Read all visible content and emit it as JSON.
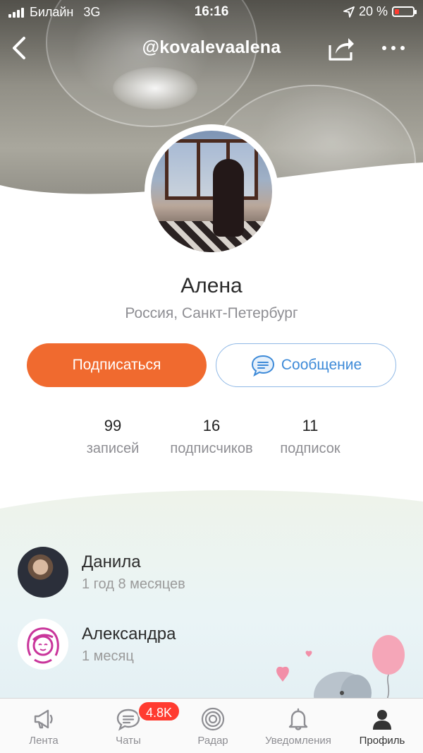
{
  "status_bar": {
    "carrier": "Билайн",
    "network": "3G",
    "time": "16:16",
    "battery": "20 %"
  },
  "header": {
    "username": "@kovalevaalena"
  },
  "profile": {
    "name": "Алена",
    "location": "Россия, Санкт-Петербург",
    "subscribe_label": "Подписаться",
    "message_label": "Сообщение"
  },
  "stats": [
    {
      "value": "99",
      "label": "записей"
    },
    {
      "value": "16",
      "label": "подписчиков"
    },
    {
      "value": "11",
      "label": "подписок"
    }
  ],
  "friends": [
    {
      "name": "Данила",
      "subtitle": "1 год 8 месяцев"
    },
    {
      "name": "Александра",
      "subtitle": "1 месяц"
    }
  ],
  "tabs": [
    {
      "label": "Лента",
      "icon": "megaphone-icon"
    },
    {
      "label": "Чаты",
      "icon": "chat-bubble-icon",
      "badge": "4.8K"
    },
    {
      "label": "Радар",
      "icon": "radar-icon"
    },
    {
      "label": "Уведомления",
      "icon": "bell-icon"
    },
    {
      "label": "Профиль",
      "icon": "person-icon",
      "active": true
    }
  ],
  "colors": {
    "accent": "#f06a2f",
    "link": "#3d8ad8",
    "badge": "#ff3b30"
  }
}
